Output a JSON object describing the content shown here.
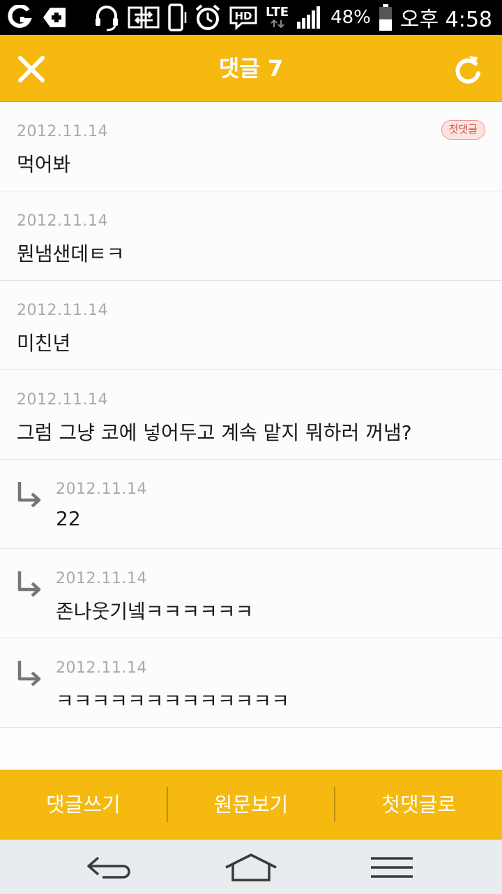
{
  "status_bar": {
    "battery_percent": "48%",
    "network": "LTE",
    "hd_label": "HD",
    "time": "오후 4:58",
    "battery_level": 0.48,
    "icons": [
      "app-o-icon",
      "medical-plus-icon",
      "headset-icon",
      "screen-share-icon",
      "phone-vibrate-icon",
      "alarm-icon",
      "hd-voice-icon",
      "lte-icon",
      "signal-icon",
      "battery-icon"
    ]
  },
  "header": {
    "title": "댓글 7",
    "close_icon": "close-icon",
    "refresh_icon": "refresh-icon",
    "accent_color": "#f5b90f"
  },
  "comments": [
    {
      "date": "2012.11.14",
      "text": "먹어봐",
      "badge": "첫댓글",
      "reply": false
    },
    {
      "date": "2012.11.14",
      "text": "뭔냄샌데ㅌㅋ",
      "reply": false
    },
    {
      "date": "2012.11.14",
      "text": "미친년",
      "reply": false
    },
    {
      "date": "2012.11.14",
      "text": "그럼 그냥 코에 넣어두고 계속 맡지 뭐하러 꺼냄?",
      "reply": false
    },
    {
      "date": "2012.11.14",
      "text": "22",
      "reply": true
    },
    {
      "date": "2012.11.14",
      "text": "존나웃기넼ㅋㅋㅋㅋㅋㅋ",
      "reply": true
    },
    {
      "date": "2012.11.14",
      "text": "ㅋㅋㅋㅋㅋㅋㅋㅋㅋㅋㅋㅋㅋ",
      "reply": true
    }
  ],
  "toolbar": {
    "write_comment": "댓글쓰기",
    "view_original": "원문보기",
    "first_comment": "첫댓글로"
  },
  "nav_bar": {
    "icons": [
      "back-icon",
      "home-icon",
      "menu-icon"
    ]
  }
}
